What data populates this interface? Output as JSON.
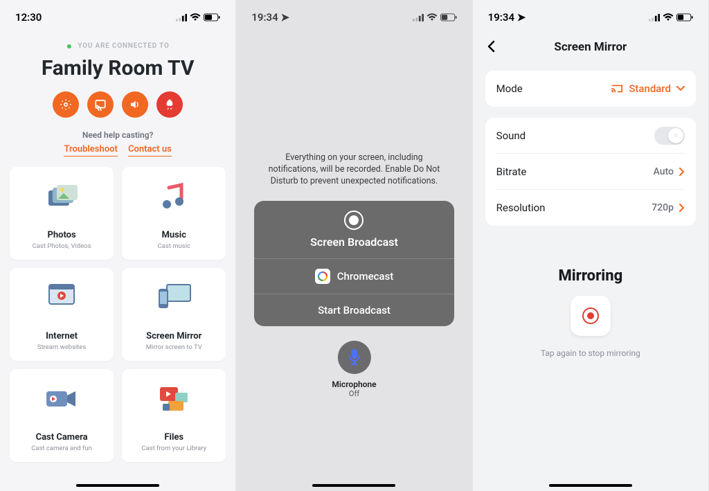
{
  "screen1": {
    "time": "12:30",
    "connected_label": "YOU ARE CONNECTED TO",
    "device_name": "Family Room TV",
    "help_question": "Need help casting?",
    "help_links": {
      "troubleshoot": "Troubleshoot",
      "contact": "Contact us"
    },
    "cards": [
      {
        "title": "Photos",
        "sub": "Cast Photos, Videos"
      },
      {
        "title": "Music",
        "sub": "Cast music"
      },
      {
        "title": "Internet",
        "sub": "Stream websites"
      },
      {
        "title": "Screen Mirror",
        "sub": "Mirror screen to TV"
      },
      {
        "title": "Cast Camera",
        "sub": "Cast camera and fun"
      },
      {
        "title": "Files",
        "sub": "Cast from your Library"
      }
    ]
  },
  "screen2": {
    "time": "19:34",
    "notice": "Everything on your screen, including notifications, will be recorded. Enable Do Not Disturb to prevent unexpected notifications.",
    "broadcast_title": "Screen Broadcast",
    "app_name": "Chromecast",
    "start_label": "Start Broadcast",
    "mic_label": "Microphone",
    "mic_state": "Off"
  },
  "screen3": {
    "time": "19:34",
    "title": "Screen Mirror",
    "mode_label": "Mode",
    "mode_value": "Standard",
    "sound_label": "Sound",
    "bitrate_label": "Bitrate",
    "bitrate_value": "Auto",
    "resolution_label": "Resolution",
    "resolution_value": "720p",
    "mirroring_title": "Mirroring",
    "tap_hint": "Tap again to stop mirroring"
  }
}
